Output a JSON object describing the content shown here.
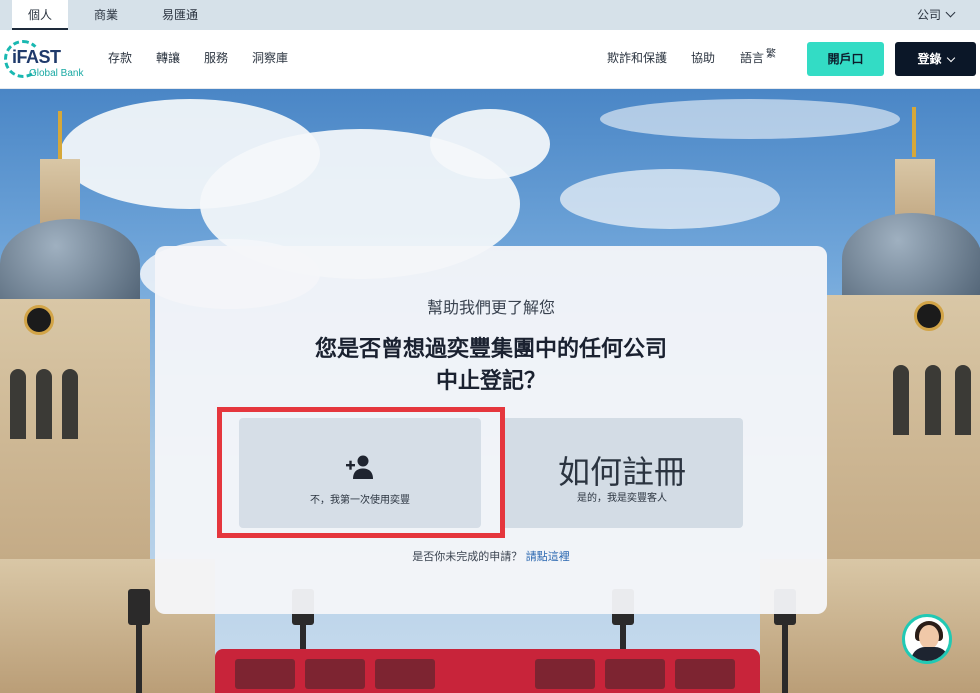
{
  "topbar": {
    "tabs": [
      "個人",
      "商業",
      "易匯通"
    ],
    "company_label": "公司"
  },
  "navbar": {
    "logo_main": "iFAST",
    "logo_sub": "Global Bank",
    "links": [
      "存款",
      "轉讓",
      "服務",
      "洞察庫"
    ],
    "right_links": [
      "欺詐和保護",
      "協助"
    ],
    "language_label": "語言",
    "language_current": "繁",
    "open_account_label": "開戶口",
    "login_label": "登錄"
  },
  "card": {
    "subtitle": "幫助我們更了解您",
    "title_line1": "您是否曾想過奕豐集團中的任何公司",
    "title_line2": "中止登記？",
    "option_new": {
      "icon": "add-user-icon",
      "label": "不，我第一次使用奕豐"
    },
    "option_existing": {
      "big_text": "如何註冊",
      "label": "是的，我是奕豐客人"
    },
    "footer_text": "是否你未完成的申請？",
    "footer_link": "請點這裡"
  },
  "colors": {
    "accent_teal": "#33dcc5",
    "navy": "#0b1728",
    "highlight_red": "#e5363d"
  },
  "chat": {
    "icon": "support-agent-avatar"
  }
}
